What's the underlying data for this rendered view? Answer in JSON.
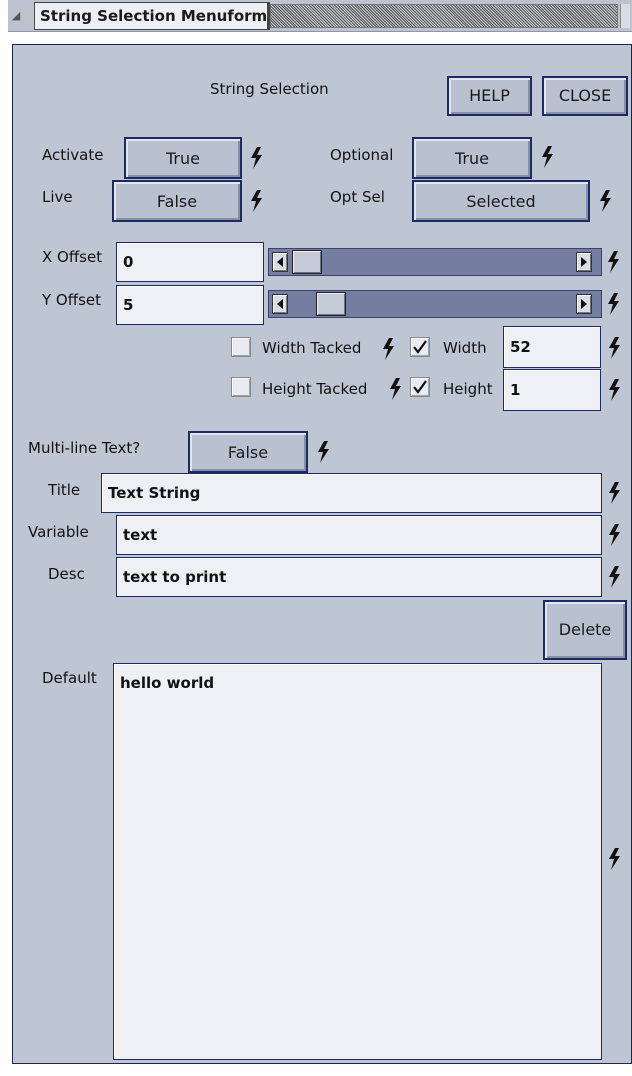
{
  "window": {
    "title": "String Selection Menuform"
  },
  "header": {
    "title": "String Selection",
    "help_label": "HELP",
    "close_label": "CLOSE"
  },
  "activate": {
    "label": "Activate",
    "value": "True"
  },
  "optional": {
    "label": "Optional",
    "value": "True"
  },
  "live": {
    "label": "Live",
    "value": "False"
  },
  "opt_sel": {
    "label": "Opt Sel",
    "value": "Selected"
  },
  "x_offset": {
    "label": "X Offset",
    "value": "0"
  },
  "y_offset": {
    "label": "Y Offset",
    "value": "5"
  },
  "width_tacked": {
    "label": "Width Tacked",
    "checked": false
  },
  "width": {
    "label": "Width",
    "checked": true,
    "value": "52"
  },
  "height_tacked": {
    "label": "Height Tacked",
    "checked": false
  },
  "height": {
    "label": "Height",
    "checked": true,
    "value": "1"
  },
  "multiline": {
    "label": "Multi-line Text?",
    "value": "False"
  },
  "title_field": {
    "label": "Title",
    "value": "Text String"
  },
  "variable_field": {
    "label": "Variable",
    "value": "text"
  },
  "desc_field": {
    "label": "Desc",
    "value": "text to print"
  },
  "delete_label": "Delete",
  "default_field": {
    "label": "Default",
    "value": "hello world"
  },
  "icons": {
    "action": "lightning-bolt-icon",
    "window_menu": "triangle-menu-icon",
    "scroll_left": "arrow-left-icon",
    "scroll_right": "arrow-right-icon",
    "check": "checkmark-icon"
  },
  "colors": {
    "panel": "#bfc6d3",
    "border": "#1e2a66",
    "field": "#eef0f4",
    "track": "#757ea0"
  }
}
